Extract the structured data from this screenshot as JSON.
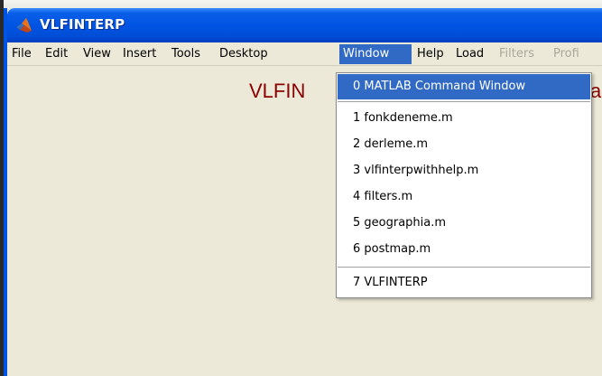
{
  "window": {
    "title": "VLFINTERP"
  },
  "menubar": {
    "items": [
      {
        "label": "File"
      },
      {
        "label": "Edit"
      },
      {
        "label": "View"
      },
      {
        "label": "Insert"
      },
      {
        "label": "Tools"
      },
      {
        "label": "Desktop"
      },
      {
        "label": "Window"
      },
      {
        "label": "Help"
      },
      {
        "label": "Load"
      },
      {
        "label": "Filters"
      },
      {
        "label": "Profi"
      }
    ],
    "active": "Window",
    "disabled": [
      "Filters",
      "Profi"
    ]
  },
  "content": {
    "heading_left": "VLFIN",
    "heading_right": "a"
  },
  "window_menu": {
    "items": [
      {
        "label": "0 MATLAB Command Window"
      },
      {
        "label": "1 fonkdeneme.m"
      },
      {
        "label": "2 derleme.m"
      },
      {
        "label": "3 vlfinterpwithhelp.m"
      },
      {
        "label": "4 filters.m"
      },
      {
        "label": "5 geographia.m"
      },
      {
        "label": "6 postmap.m"
      },
      {
        "label": "7 VLFINTERP"
      }
    ],
    "highlighted": "0 MATLAB Command Window"
  },
  "colors": {
    "titlebar": "#0054e3",
    "menu_highlight": "#316ac5",
    "heading_text": "#8b0000",
    "background": "#ece9d8"
  },
  "icons": {
    "app": "matlab-logo-icon"
  }
}
